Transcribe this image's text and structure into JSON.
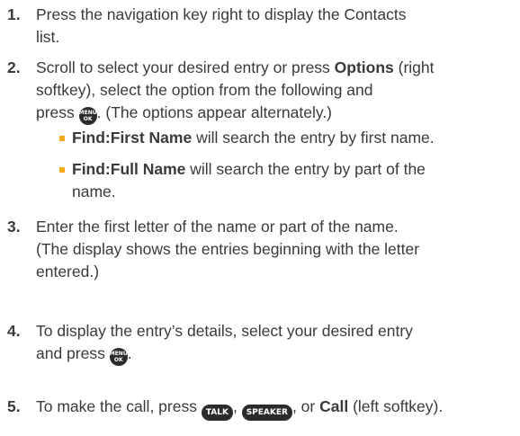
{
  "steps": [
    {
      "number": "1.",
      "line1": "Press the navigation key right to display the Contacts",
      "line2": "list."
    },
    {
      "number": "2.",
      "line1_pre": "Scroll to select your desired entry or press ",
      "line1_bold": "Options",
      "line1_post": " (right",
      "line2": "softkey), select the option from the following and",
      "line3_pre": "press ",
      "line3_post": ". (The options appear alternately.)",
      "bullets": [
        {
          "bold": "Find:First Name",
          "rest": " will search the entry by first name."
        },
        {
          "bold": "Find:Full Name",
          "rest": " will search the entry by part of the",
          "rest_line2": "name."
        }
      ]
    },
    {
      "number": "3.",
      "line1": "Enter the first letter of the name or part of the name.",
      "line2": "(The display shows the entries beginning with the letter",
      "line3": "entered.)"
    },
    {
      "number": "4.",
      "line1": "To display the entry’s details, select your desired entry",
      "line2_pre": "and press ",
      "line2_post": "."
    },
    {
      "number": "5.",
      "pre": "To make the call, press ",
      "sep1": ", ",
      "sep2": ", or ",
      "call_bold": "Call",
      "post": " (left softkey)."
    }
  ],
  "keys": {
    "menu_ok_top": "MENU",
    "menu_ok_bottom": "OK",
    "talk": "TALK",
    "speaker": "SPEAKER"
  },
  "colors": {
    "text": "#3a3a3a",
    "bullet": "#f5a81c",
    "key_bg": "#2b2b2b"
  }
}
